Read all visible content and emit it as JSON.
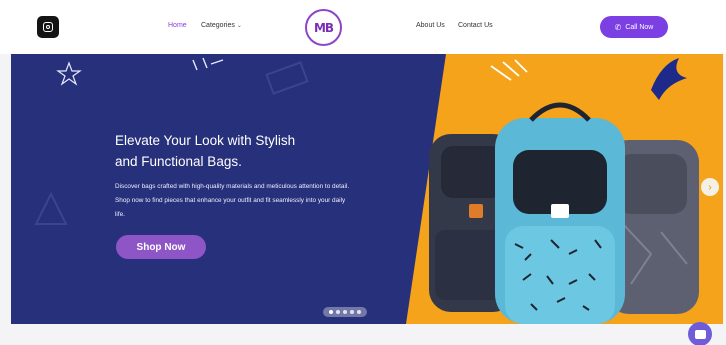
{
  "header": {
    "nav": {
      "home": "Home",
      "categories": "Categories",
      "about": "About Us",
      "contact": "Contact Us"
    },
    "logo_text": "MB",
    "call_button": "Call Now"
  },
  "hero": {
    "title_line1": "Elevate Your Look with Stylish",
    "title_line2": "and Functional Bags.",
    "description": "Discover bags crafted with high-quality materials and meticulous attention to detail. Shop now to find pieces that enhance your outfit and fit seamlessly into your daily life.",
    "cta": "Shop Now",
    "slides_count": 5
  },
  "colors": {
    "accent_purple": "#7b3fe4",
    "hero_navy": "#27307a",
    "hero_orange": "#f5a31a",
    "cta_purple": "#8d55c6"
  },
  "icons": [
    "instagram-icon",
    "chevron-down-icon",
    "phone-icon",
    "chevron-right-icon",
    "chat-icon"
  ]
}
